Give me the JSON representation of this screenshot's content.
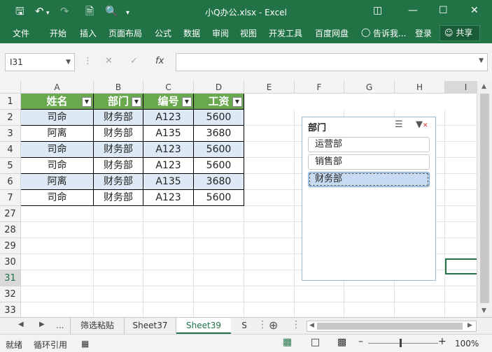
{
  "window": {
    "title": "小Q办公.xlsx - Excel"
  },
  "qat": {
    "save_icon": "save-icon",
    "undo_icon": "undo-icon",
    "redo_icon": "redo-icon",
    "new_icon": "new-file-icon",
    "preview_icon": "print-preview-icon",
    "more_icon": "customize-icon"
  },
  "ribbon": {
    "tabs": [
      "文件",
      "开始",
      "插入",
      "页面布局",
      "公式",
      "数据",
      "审阅",
      "视图",
      "开发工具",
      "百度网盘"
    ],
    "tell_me": "告诉我...",
    "login": "登录",
    "share": "共享"
  },
  "formula_bar": {
    "name_box": "I31",
    "fx": "fx",
    "value": ""
  },
  "columns": [
    "A",
    "B",
    "C",
    "D",
    "E",
    "F",
    "G",
    "H",
    "I"
  ],
  "rows": [
    "1",
    "2",
    "3",
    "4",
    "5",
    "6",
    "7",
    "27",
    "28",
    "29",
    "30",
    "31",
    "32",
    "33",
    "34"
  ],
  "table": {
    "headers": [
      "姓名",
      "部门",
      "编号",
      "工资"
    ],
    "data": [
      [
        "司命",
        "财务部",
        "A123",
        "5600"
      ],
      [
        "阿离",
        "财务部",
        "A135",
        "3680"
      ],
      [
        "司命",
        "财务部",
        "A123",
        "5600"
      ],
      [
        "司命",
        "财务部",
        "A123",
        "5600"
      ],
      [
        "阿离",
        "财务部",
        "A135",
        "3680"
      ],
      [
        "司命",
        "财务部",
        "A123",
        "5600"
      ]
    ]
  },
  "slicer": {
    "title": "部门",
    "items": [
      "运营部",
      "销售部",
      "财务部"
    ],
    "selected": "财务部"
  },
  "sheet_tabs": {
    "ellipsis": "...",
    "tabs": [
      "筛选粘贴",
      "Sheet37",
      "Sheet39",
      "S"
    ],
    "active": "Sheet39"
  },
  "status": {
    "mode": "就绪",
    "circular": "循环引用",
    "zoom": "100%"
  },
  "colors": {
    "accent": "#217346",
    "header_fill": "#6aa84f",
    "band": "#dde9f5",
    "slicer_selected": "#c7dcf3"
  }
}
